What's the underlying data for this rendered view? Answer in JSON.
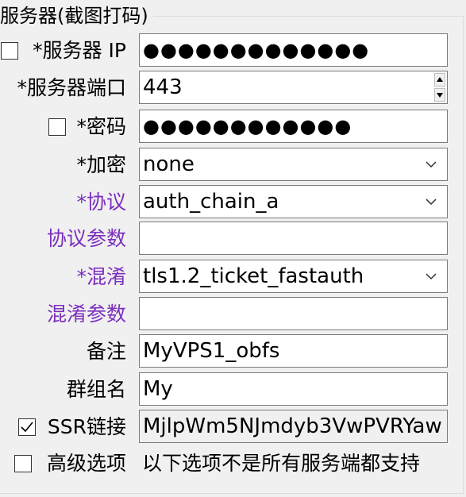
{
  "group": {
    "title": "服务器(截图打码)"
  },
  "server_ip": {
    "label": "*服务器 IP",
    "value": "●●●●●●●●●●●●●",
    "show_checked": false
  },
  "server_port": {
    "label": "*服务器端口",
    "value": "443"
  },
  "password": {
    "label": "*密码",
    "value": "●●●●●●●●●●●●",
    "show_checked": false
  },
  "encryption": {
    "label": "*加密",
    "value": "none"
  },
  "protocol": {
    "label": "*协议",
    "value": "auth_chain_a"
  },
  "protocol_param": {
    "label": "协议参数",
    "value": ""
  },
  "obfs": {
    "label": "*混淆",
    "value": "tls1.2_ticket_fastauth"
  },
  "obfs_param": {
    "label": "混淆参数",
    "value": ""
  },
  "remarks": {
    "label": "备注",
    "value": "MyVPS1_obfs"
  },
  "group_name": {
    "label": "群组名",
    "value": "My"
  },
  "ssr_link": {
    "label": "SSR链接",
    "value": "MjlpWm5NJmdyb3VwPVRYaw",
    "checked": true
  },
  "advanced": {
    "label": "高级选项",
    "checked": false,
    "note": "以下选项不是所有服务端都支持"
  },
  "colors": {
    "accent_purple": "#7b2fbe",
    "border": "#7a7a7a",
    "background": "#f0f0f0"
  }
}
